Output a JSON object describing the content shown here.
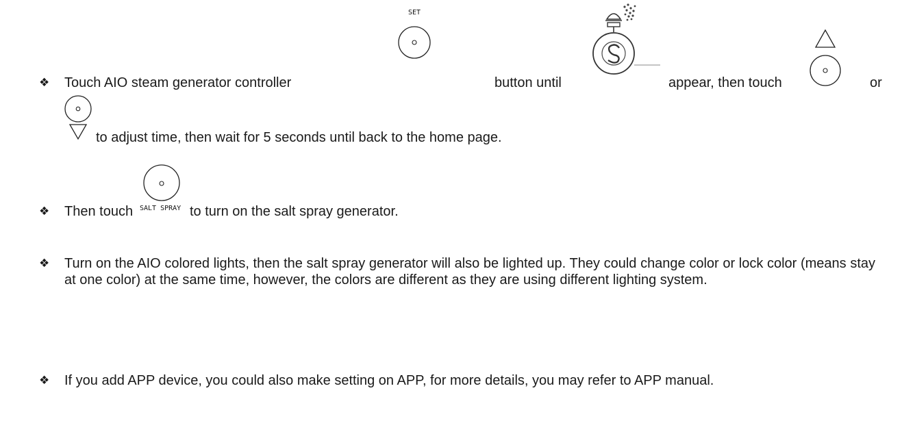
{
  "bullet_glyph": "❖",
  "step1": {
    "text_a": "Touch AIO steam generator controller",
    "set_label": "SET",
    "text_b": "button until",
    "text_c": "appear, then touch",
    "text_d": "or",
    "text_e": "to adjust time, then wait for 5 seconds until back to the home page."
  },
  "step2": {
    "text_a": "Then touch",
    "salt_label": "SALT SPRAY",
    "text_b": "to turn on the salt spray generator."
  },
  "step3": {
    "text": "Turn on the AIO colored lights, then the salt spray generator will also be lighted up. They could change color or lock color (means stay at one color) at the same time, however, the colors are different as they are using different lighting system."
  },
  "step4": {
    "text": "If you add APP device, you could also make setting on APP, for more details, you may refer to APP manual."
  }
}
